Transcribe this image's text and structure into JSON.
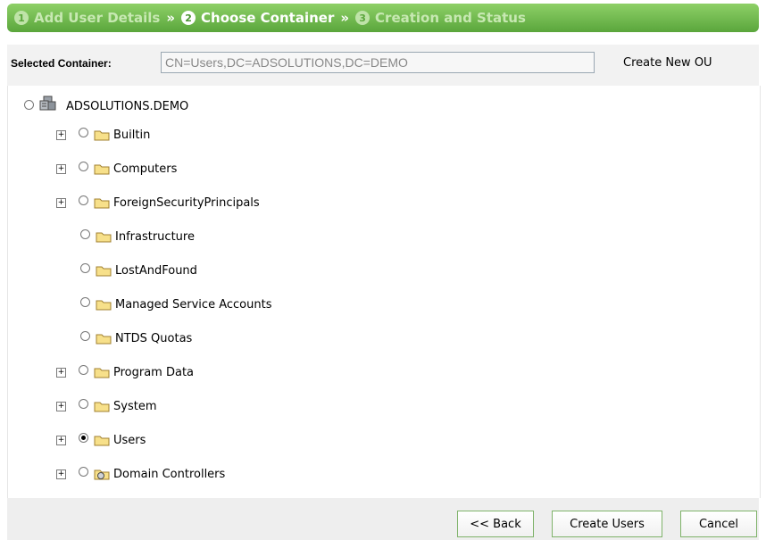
{
  "wizard": {
    "steps": [
      {
        "num": "1",
        "label": "Add User Details"
      },
      {
        "num": "2",
        "label": "Choose Container"
      },
      {
        "num": "3",
        "label": "Creation and Status"
      }
    ],
    "separator": "»"
  },
  "container": {
    "label": "Selected Container:",
    "value": "CN=Users,DC=ADSOLUTIONS,DC=DEMO",
    "create_ou": "Create New OU"
  },
  "tree": {
    "root": "ADSOLUTIONS.DEMO",
    "items": [
      {
        "label": "Builtin",
        "expandable": true,
        "selected": false
      },
      {
        "label": "Computers",
        "expandable": true,
        "selected": false
      },
      {
        "label": "ForeignSecurityPrincipals",
        "expandable": true,
        "selected": false
      },
      {
        "label": "Infrastructure",
        "expandable": false,
        "selected": false
      },
      {
        "label": "LostAndFound",
        "expandable": false,
        "selected": false
      },
      {
        "label": "Managed Service Accounts",
        "expandable": false,
        "selected": false
      },
      {
        "label": "NTDS Quotas",
        "expandable": false,
        "selected": false
      },
      {
        "label": "Program Data",
        "expandable": true,
        "selected": false
      },
      {
        "label": "System",
        "expandable": true,
        "selected": false
      },
      {
        "label": "Users",
        "expandable": true,
        "selected": true
      },
      {
        "label": "Domain Controllers",
        "expandable": true,
        "selected": false
      }
    ],
    "expander_symbol": "+"
  },
  "buttons": {
    "back": "<< Back",
    "create": "Create Users",
    "cancel": "Cancel"
  },
  "colors": {
    "wizard_green": "#5aa63c",
    "folder_yellow": "#f7e08a"
  }
}
